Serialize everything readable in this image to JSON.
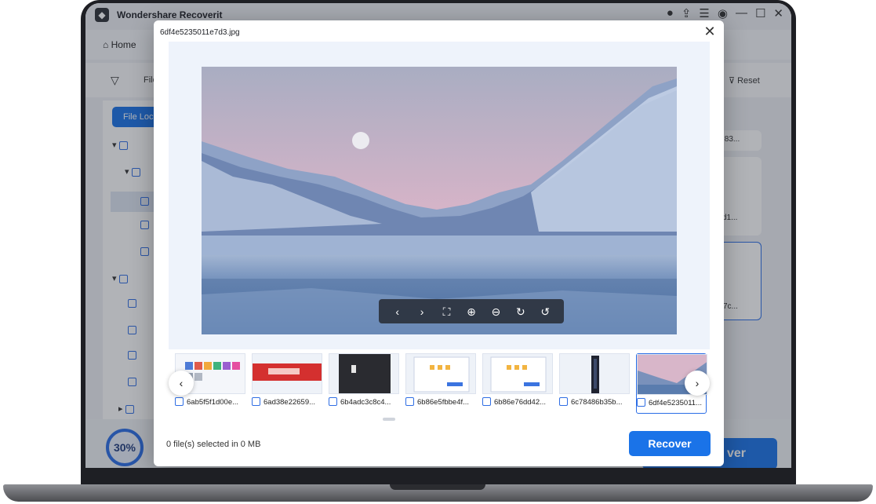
{
  "app": {
    "title": "Wondershare Recoverit",
    "home_tab": "Home",
    "filter_label": "File",
    "reset_label": "Reset",
    "file_location_button": "File Loc",
    "right_card_labels": [
      ":83...",
      "d1...",
      "7c..."
    ],
    "progress": "30%",
    "bg_recover_label": "ver"
  },
  "modal": {
    "title": "6df4e5235011e7d3.jpg",
    "status": "0 file(s) selected in 0 MB",
    "recover_label": "Recover",
    "toolbar_icons": [
      "chevron-left-icon",
      "chevron-right-icon",
      "fullscreen-icon",
      "zoom-in-icon",
      "zoom-out-icon",
      "rotate-right-icon",
      "rotate-left-icon"
    ],
    "thumbnails": [
      {
        "label": "6ab5f5f1d00e..."
      },
      {
        "label": "6ad38e22659..."
      },
      {
        "label": "6b4adc3c8c4..."
      },
      {
        "label": "6b86e5fbbe4f..."
      },
      {
        "label": "6b86e76dd42..."
      },
      {
        "label": "6c78486b35b..."
      },
      {
        "label": "6df4e5235011..."
      }
    ]
  },
  "colors": {
    "accent": "#1a73e8",
    "checkbox": "#2f6ee4"
  }
}
